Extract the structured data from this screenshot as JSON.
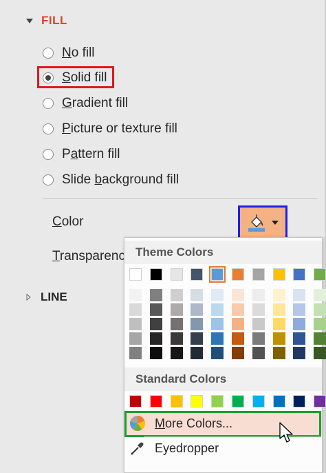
{
  "fill_section": {
    "title": "FILL"
  },
  "fill_options": [
    {
      "key": "no-fill",
      "pre": "",
      "ul": "N",
      "post": "o fill",
      "checked": false
    },
    {
      "key": "solid-fill",
      "pre": "",
      "ul": "S",
      "post": "olid fill",
      "checked": true
    },
    {
      "key": "gradient-fill",
      "pre": "",
      "ul": "G",
      "post": "radient fill",
      "checked": false
    },
    {
      "key": "picture-texture-fill",
      "pre": "",
      "ul": "P",
      "post": "icture or texture fill",
      "checked": false
    },
    {
      "key": "pattern-fill",
      "pre": "P",
      "ul": "a",
      "post": "ttern fill",
      "checked": false
    },
    {
      "key": "slide-background-fill",
      "pre": "Slide ",
      "ul": "b",
      "post": "ackground fill",
      "checked": false
    }
  ],
  "properties": {
    "color_label": "Color",
    "color_label_ul": "C",
    "transparency_label": "Transparenc",
    "transparency_ul": "T"
  },
  "color_button": {
    "current_color": "#F4B183",
    "icon": "paint-bucket-icon"
  },
  "line_section": {
    "title": "LINE"
  },
  "color_picker": {
    "theme_colors_header": "Theme Colors",
    "standard_colors_header": "Standard Colors",
    "more_colors_label": "More Colors...",
    "more_colors_ul": "M",
    "eyedropper_label": "Eyedropper",
    "theme_colors": [
      "#FFFFFF",
      "#000000",
      "#E7E6E6",
      "#44546A",
      "#5B9BD5",
      "#ED7D31",
      "#A5A5A5",
      "#FFC000",
      "#4472C4",
      "#70AD47"
    ],
    "selected_theme_index": 4,
    "theme_shades": [
      [
        "#F2F2F2",
        "#D9D9D9",
        "#BFBFBF",
        "#A6A6A6",
        "#808080"
      ],
      [
        "#808080",
        "#595959",
        "#404040",
        "#262626",
        "#0D0D0D"
      ],
      [
        "#D0CECE",
        "#AEAAAA",
        "#757171",
        "#3A3838",
        "#171616"
      ],
      [
        "#D6DCE4",
        "#ADB9CA",
        "#8497B0",
        "#333F4F",
        "#222A35"
      ],
      [
        "#DEEBF7",
        "#BDD7EE",
        "#9DC3E6",
        "#2E75B6",
        "#1F4E79"
      ],
      [
        "#FBE5D6",
        "#F8CBAD",
        "#F4B183",
        "#C55A11",
        "#843C0C"
      ],
      [
        "#EDEDED",
        "#DBDBDB",
        "#C9C9C9",
        "#7B7B7B",
        "#525252"
      ],
      [
        "#FFF2CC",
        "#FFE699",
        "#FFD966",
        "#BF9000",
        "#7F6000"
      ],
      [
        "#D9E2F3",
        "#B4C7E7",
        "#8FAADC",
        "#2F5597",
        "#203864"
      ],
      [
        "#E2F0D9",
        "#C5E0B4",
        "#A9D18E",
        "#548235",
        "#385723"
      ]
    ],
    "standard_colors": [
      "#C00000",
      "#FF0000",
      "#FFC000",
      "#FFFF00",
      "#92D050",
      "#00B050",
      "#00B0F0",
      "#0070C0",
      "#002060",
      "#7030A0"
    ]
  }
}
